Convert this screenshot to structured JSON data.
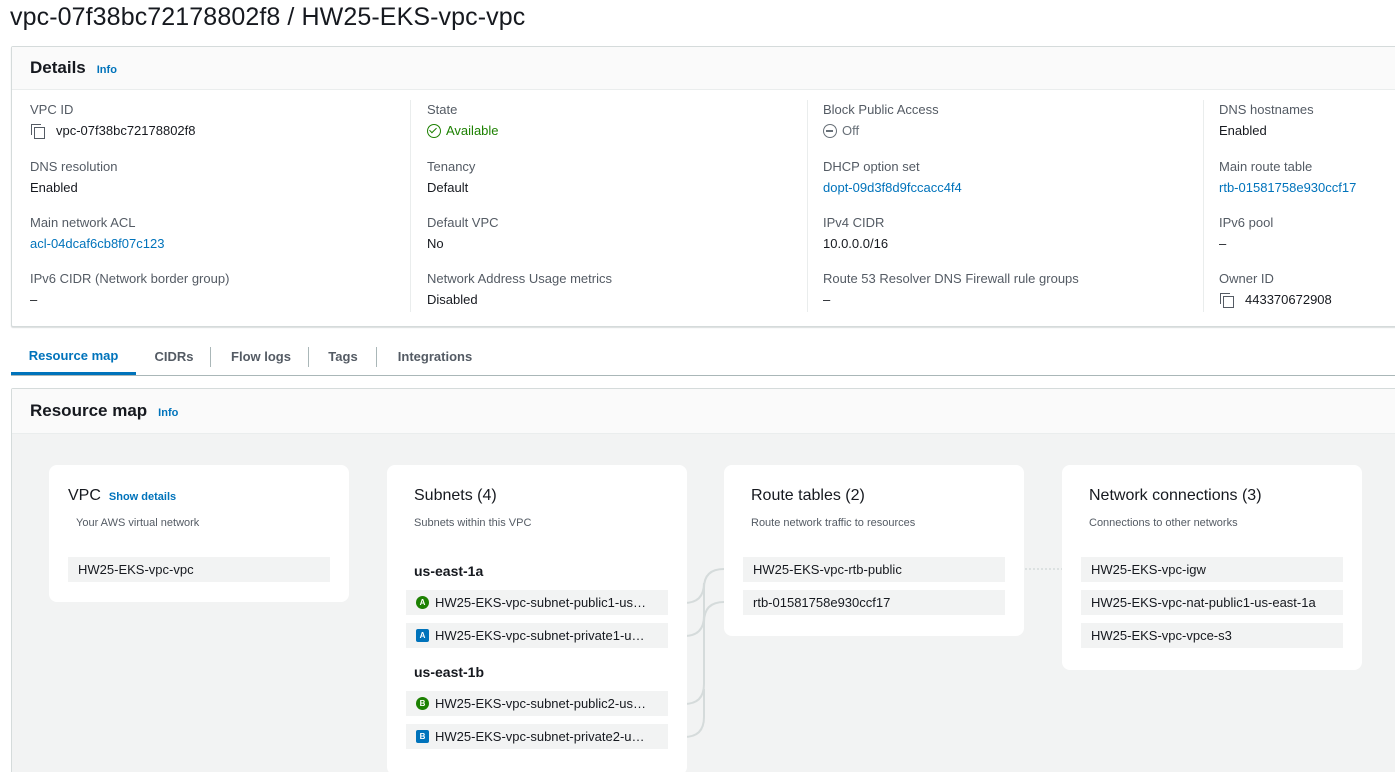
{
  "page": {
    "title": "vpc-07f38bc72178802f8 / HW25-EKS-vpc-vpc"
  },
  "details": {
    "heading": "Details",
    "info_label": "Info",
    "fields": {
      "vpc_id": {
        "label": "VPC ID",
        "value": "vpc-07f38bc72178802f8"
      },
      "state": {
        "label": "State",
        "value": "Available"
      },
      "block_public_access": {
        "label": "Block Public Access",
        "value": "Off"
      },
      "dns_hostnames": {
        "label": "DNS hostnames",
        "value": "Enabled"
      },
      "dns_resolution": {
        "label": "DNS resolution",
        "value": "Enabled"
      },
      "tenancy": {
        "label": "Tenancy",
        "value": "Default"
      },
      "dhcp_option_set": {
        "label": "DHCP option set",
        "value": "dopt-09d3f8d9fccacc4f4"
      },
      "main_route_table": {
        "label": "Main route table",
        "value": "rtb-01581758e930ccf17"
      },
      "main_network_acl": {
        "label": "Main network ACL",
        "value": "acl-04dcaf6cb8f07c123"
      },
      "default_vpc": {
        "label": "Default VPC",
        "value": "No"
      },
      "ipv4_cidr": {
        "label": "IPv4 CIDR",
        "value": "10.0.0.0/16"
      },
      "ipv6_pool": {
        "label": "IPv6 pool",
        "value": "–"
      },
      "ipv6_cidr": {
        "label": "IPv6 CIDR (Network border group)",
        "value": "–"
      },
      "nau_metrics": {
        "label": "Network Address Usage metrics",
        "value": "Disabled"
      },
      "route53_fw": {
        "label": "Route 53 Resolver DNS Firewall rule groups",
        "value": "–"
      },
      "owner_id": {
        "label": "Owner ID",
        "value": "443370672908"
      }
    },
    "status_color": "#1d8102",
    "link_color": "#0073bb"
  },
  "tabs": [
    "Resource map",
    "CIDRs",
    "Flow logs",
    "Tags",
    "Integrations"
  ],
  "resource_map": {
    "heading": "Resource map",
    "info_label": "Info",
    "vpc_card": {
      "title": "VPC",
      "show_details": "Show details",
      "subtitle": "Your AWS virtual network",
      "item": "HW25-EKS-vpc-vpc"
    },
    "subnets_card": {
      "title": "Subnets (4)",
      "subtitle": "Subnets within this VPC",
      "zones": [
        {
          "name": "us-east-1a",
          "subnets": [
            {
              "badge": "A",
              "kind": "public",
              "name": "HW25-EKS-vpc-subnet-public1-us…"
            },
            {
              "badge": "A",
              "kind": "private",
              "name": "HW25-EKS-vpc-subnet-private1-u…"
            }
          ]
        },
        {
          "name": "us-east-1b",
          "subnets": [
            {
              "badge": "B",
              "kind": "public",
              "name": "HW25-EKS-vpc-subnet-public2-us…"
            },
            {
              "badge": "B",
              "kind": "private",
              "name": "HW25-EKS-vpc-subnet-private2-u…"
            }
          ]
        }
      ]
    },
    "route_tables_card": {
      "title": "Route tables (2)",
      "subtitle": "Route network traffic to resources",
      "items": [
        "HW25-EKS-vpc-rtb-public",
        "rtb-01581758e930ccf17"
      ]
    },
    "network_connections_card": {
      "title": "Network connections (3)",
      "subtitle": "Connections to other networks",
      "items": [
        "HW25-EKS-vpc-igw",
        "HW25-EKS-vpc-nat-public1-us-east-1a",
        "HW25-EKS-vpc-vpce-s3"
      ]
    }
  }
}
